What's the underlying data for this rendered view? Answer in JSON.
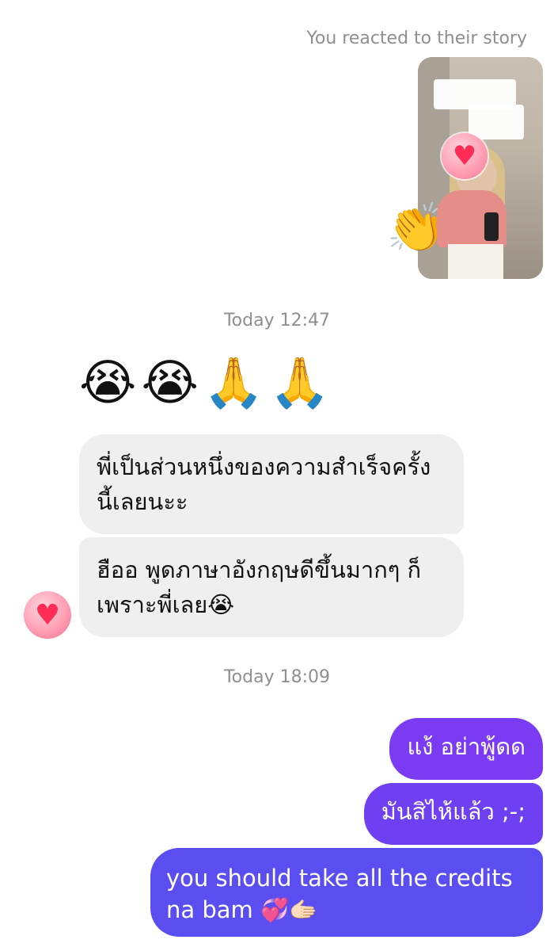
{
  "story": {
    "caption": "You reacted to their story",
    "reaction_icon": "heart-icon",
    "reaction_glyph": "♥",
    "sticker_icon": "clapping-hands-icon",
    "sticker_glyph": "👏"
  },
  "timestamps": [
    "Today 12:47",
    "Today 18:09"
  ],
  "received": {
    "emoji_row": "😭😭🙏🙏",
    "messages": [
      "พี่เป็นส่วนหนึ่งของความสำเร็จครั้งนี้เลยนะะ",
      "ฮืออ พูดภาษาอังกฤษดีขึ้นมากๆ ก็เพราะพี่เลย😭"
    ],
    "reaction_glyph": "♥"
  },
  "sent": {
    "messages": [
      "แง้ อย่าพู้ดด",
      "มันสิไห้แล้ว ;-;",
      "you should take all the credits na bam 💞🫱🏻"
    ]
  },
  "colors": {
    "sent_bubble": "#6d43f2",
    "received_bubble": "#efefef",
    "meta_text": "#8e8e93"
  }
}
